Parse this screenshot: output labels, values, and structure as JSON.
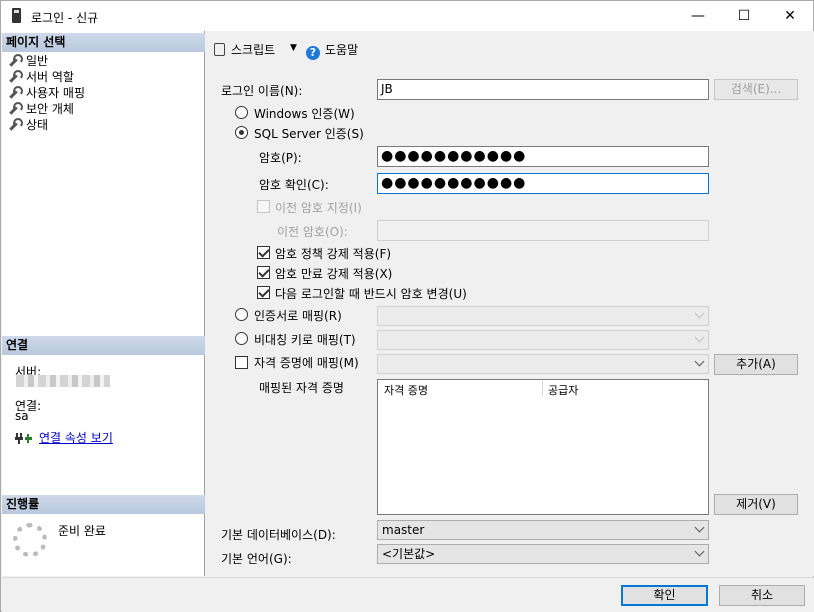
{
  "window": {
    "title": "로그인 - 신규",
    "minimize": "—",
    "maximize": "☐",
    "close": "✕"
  },
  "sidebar": {
    "pages_header": "페이지 선택",
    "pages": [
      "일반",
      "서버 역할",
      "사용자 매핑",
      "보안 개체",
      "상태"
    ],
    "connection_header": "연결",
    "server_label": "서버:",
    "connection_label": "연결:",
    "connection_value": "sa",
    "view_props_link": "연결 속성 보기",
    "progress_header": "진행률",
    "progress_status": "준비 완료"
  },
  "toolbar": {
    "script_label": "스크립트",
    "dropdown": "▼",
    "help_label": "도움말",
    "help_glyph": "?"
  },
  "form": {
    "login_name_label": "로그인 이름(N):",
    "login_name_value": "JB",
    "search_button": "검색(E)...",
    "windows_auth": "Windows 인증(W)",
    "sql_auth": "SQL Server 인증(S)",
    "password_label": "암호(P):",
    "password_value": "●●●●●●●●●●●",
    "confirm_label": "암호 확인(C):",
    "confirm_value": "●●●●●●●●●●●",
    "specify_old": "이전 암호 지정(I)",
    "old_password_label": "이전 암호(O):",
    "enforce_policy": "암호 정책 강제 적용(F)",
    "enforce_expiration": "암호 만료 강제 적용(X)",
    "must_change": "다음 로그인할 때 반드시 암호 변경(U)",
    "cert_map": "인증서로 매핑(R)",
    "asym_map": "비대칭 키로 매핑(T)",
    "credential_map": "자격 증명에 매핑(M)",
    "add_button": "추가(A)",
    "mapped_credentials_label": "매핑된 자격 증명",
    "grid_headers": [
      "자격 증명",
      "공급자"
    ],
    "remove_button": "제거(V)",
    "default_db_label": "기본 데이터베이스(D):",
    "default_db_value": "master",
    "default_lang_label": "기본 언어(G):",
    "default_lang_value": "<기본값>"
  },
  "footer": {
    "ok": "확인",
    "cancel": "취소"
  }
}
